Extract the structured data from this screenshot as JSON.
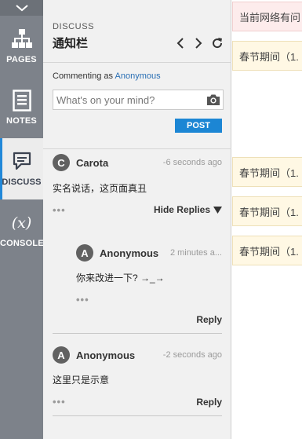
{
  "rail": {
    "items": [
      {
        "label": "PAGES",
        "icon": "sitemap-icon"
      },
      {
        "label": "NOTES",
        "icon": "notes-icon"
      },
      {
        "label": "DISCUSS",
        "icon": "discuss-icon"
      },
      {
        "label": "CONSOLE",
        "icon": "console-icon",
        "glyph": "(x)"
      }
    ],
    "active": "DISCUSS"
  },
  "panel": {
    "kicker": "DISCUSS",
    "title": "通知栏",
    "commenting_prefix": "Commenting as",
    "commenting_user": "Anonymous",
    "input_placeholder": "What's on your mind?",
    "post_label": "POST"
  },
  "comments": [
    {
      "avatar": "C",
      "author": "Carota",
      "time": "-6 seconds ago",
      "text": "实名说话，这页面真丑",
      "dots": "•••",
      "action": "Hide Replies"
    },
    {
      "avatar": "A",
      "author": "Anonymous",
      "time": "2 minutes a...",
      "text": "你来改进一下? →_→",
      "dots": "•••",
      "action": "Reply"
    },
    {
      "avatar": "A",
      "author": "Anonymous",
      "time": "-2 seconds ago",
      "text": "这里只是示意",
      "dots": "•••",
      "action": "Reply"
    }
  ],
  "content": {
    "cells": [
      "当前网络有问",
      "春节期间（1.",
      "春节期间（1.",
      "春节期间（1.",
      "春节期间（1."
    ]
  },
  "colors": {
    "accent": "#1c86d4",
    "rail": "#7d828a",
    "panel": "#f1f1f1"
  }
}
